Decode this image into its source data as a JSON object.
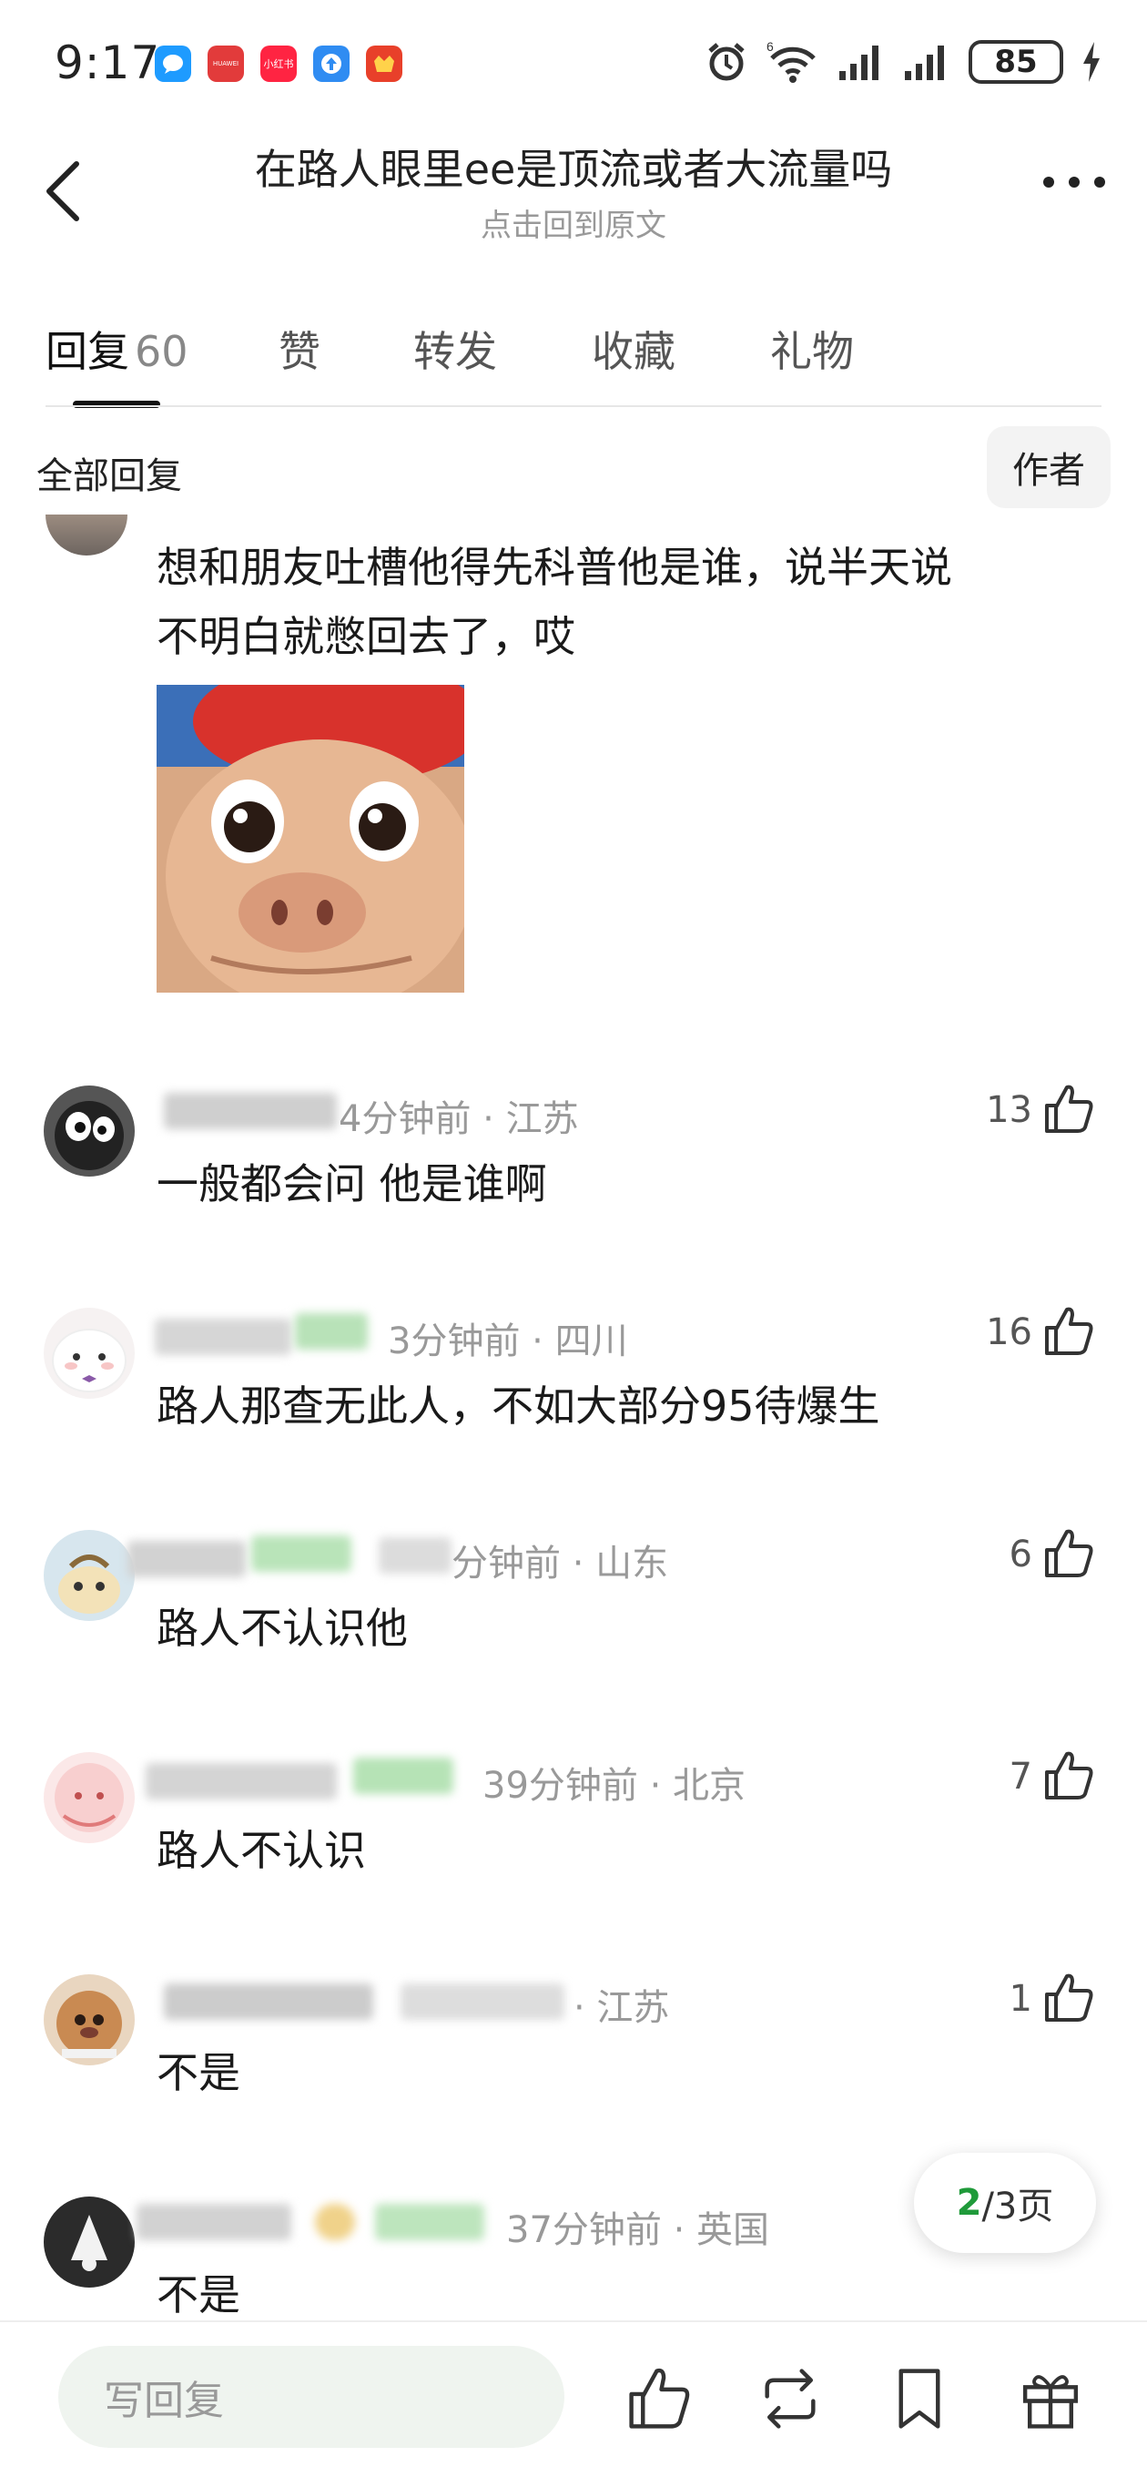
{
  "status_bar": {
    "time": "9:17",
    "battery": "85",
    "app_icons": [
      {
        "name": "chat-app-icon",
        "color": "#1e9bff",
        "label": ""
      },
      {
        "name": "huawei-app-icon",
        "color": "#e23b3b",
        "label": "HUAWEI"
      },
      {
        "name": "xiaohongshu-app-icon",
        "color": "#ff2442",
        "label": "小红书"
      },
      {
        "name": "upload-app-icon",
        "color": "#2f8cf2",
        "label": ""
      },
      {
        "name": "shop-app-icon",
        "color": "#e8402a",
        "label": ""
      }
    ]
  },
  "header": {
    "title": "在路人眼里ee是顶流或者大流量吗",
    "subtitle": "点击回到原文"
  },
  "tabs": [
    {
      "label": "回复",
      "count": "60",
      "active": true
    },
    {
      "label": "赞",
      "count": "",
      "active": false
    },
    {
      "label": "转发",
      "count": "",
      "active": false
    },
    {
      "label": "收藏",
      "count": "",
      "active": false
    },
    {
      "label": "礼物",
      "count": "",
      "active": false
    }
  ],
  "filter": {
    "all_label": "全部回复",
    "author_label": "作者"
  },
  "first_comment": {
    "line1": "想和朋友吐槽他得先科普他是谁，说半天说",
    "line2": "不明白就憋回去了，哎"
  },
  "comments": [
    {
      "meta": "4分钟前 · 江苏",
      "likes": "13",
      "text": "一般都会问 他是谁啊"
    },
    {
      "meta": "3分钟前 · 四川",
      "likes": "16",
      "text": "路人那查无此人，不如大部分95待爆生"
    },
    {
      "meta": "分钟前 · 山东",
      "likes": "6",
      "text": "路人不认识他"
    },
    {
      "meta": "39分钟前 · 北京",
      "likes": "7",
      "text": "路人不认识"
    },
    {
      "meta": "· 江苏",
      "likes": "1",
      "text": "不是"
    },
    {
      "meta": "37分钟前 · 英国",
      "likes": "",
      "text": "不是"
    }
  ],
  "pagination": {
    "current": "2",
    "rest": "/3页"
  },
  "bottom_bar": {
    "reply_placeholder": "写回复",
    "icons": [
      "like-icon",
      "repost-icon",
      "bookmark-icon",
      "gift-icon"
    ]
  }
}
